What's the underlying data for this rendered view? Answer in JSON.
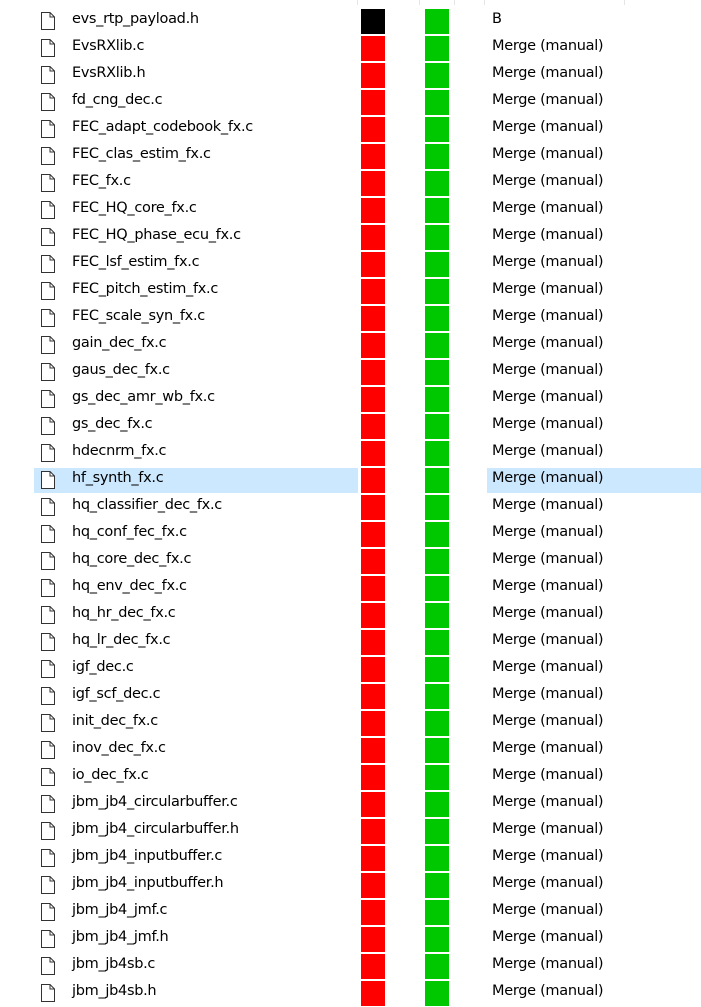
{
  "colors": {
    "red": "#ff0000",
    "green": "#00c800",
    "black": "#000000",
    "selected_row": "#cce8ff"
  },
  "rows": [
    {
      "name": "evs_rtp_payload.h",
      "left_swatch": "black",
      "right_swatch": "green",
      "action": "B",
      "selected": false
    },
    {
      "name": "EvsRXlib.c",
      "left_swatch": "red",
      "right_swatch": "green",
      "action": "Merge (manual)",
      "selected": false
    },
    {
      "name": "EvsRXlib.h",
      "left_swatch": "red",
      "right_swatch": "green",
      "action": "Merge (manual)",
      "selected": false
    },
    {
      "name": "fd_cng_dec.c",
      "left_swatch": "red",
      "right_swatch": "green",
      "action": "Merge (manual)",
      "selected": false
    },
    {
      "name": "FEC_adapt_codebook_fx.c",
      "left_swatch": "red",
      "right_swatch": "green",
      "action": "Merge (manual)",
      "selected": false
    },
    {
      "name": "FEC_clas_estim_fx.c",
      "left_swatch": "red",
      "right_swatch": "green",
      "action": "Merge (manual)",
      "selected": false
    },
    {
      "name": "FEC_fx.c",
      "left_swatch": "red",
      "right_swatch": "green",
      "action": "Merge (manual)",
      "selected": false
    },
    {
      "name": "FEC_HQ_core_fx.c",
      "left_swatch": "red",
      "right_swatch": "green",
      "action": "Merge (manual)",
      "selected": false
    },
    {
      "name": "FEC_HQ_phase_ecu_fx.c",
      "left_swatch": "red",
      "right_swatch": "green",
      "action": "Merge (manual)",
      "selected": false
    },
    {
      "name": "FEC_lsf_estim_fx.c",
      "left_swatch": "red",
      "right_swatch": "green",
      "action": "Merge (manual)",
      "selected": false
    },
    {
      "name": "FEC_pitch_estim_fx.c",
      "left_swatch": "red",
      "right_swatch": "green",
      "action": "Merge (manual)",
      "selected": false
    },
    {
      "name": "FEC_scale_syn_fx.c",
      "left_swatch": "red",
      "right_swatch": "green",
      "action": "Merge (manual)",
      "selected": false
    },
    {
      "name": "gain_dec_fx.c",
      "left_swatch": "red",
      "right_swatch": "green",
      "action": "Merge (manual)",
      "selected": false
    },
    {
      "name": "gaus_dec_fx.c",
      "left_swatch": "red",
      "right_swatch": "green",
      "action": "Merge (manual)",
      "selected": false
    },
    {
      "name": "gs_dec_amr_wb_fx.c",
      "left_swatch": "red",
      "right_swatch": "green",
      "action": "Merge (manual)",
      "selected": false
    },
    {
      "name": "gs_dec_fx.c",
      "left_swatch": "red",
      "right_swatch": "green",
      "action": "Merge (manual)",
      "selected": false
    },
    {
      "name": "hdecnrm_fx.c",
      "left_swatch": "red",
      "right_swatch": "green",
      "action": "Merge (manual)",
      "selected": false
    },
    {
      "name": "hf_synth_fx.c",
      "left_swatch": "red",
      "right_swatch": "green",
      "action": "Merge (manual)",
      "selected": true
    },
    {
      "name": "hq_classifier_dec_fx.c",
      "left_swatch": "red",
      "right_swatch": "green",
      "action": "Merge (manual)",
      "selected": false
    },
    {
      "name": "hq_conf_fec_fx.c",
      "left_swatch": "red",
      "right_swatch": "green",
      "action": "Merge (manual)",
      "selected": false
    },
    {
      "name": "hq_core_dec_fx.c",
      "left_swatch": "red",
      "right_swatch": "green",
      "action": "Merge (manual)",
      "selected": false
    },
    {
      "name": "hq_env_dec_fx.c",
      "left_swatch": "red",
      "right_swatch": "green",
      "action": "Merge (manual)",
      "selected": false
    },
    {
      "name": "hq_hr_dec_fx.c",
      "left_swatch": "red",
      "right_swatch": "green",
      "action": "Merge (manual)",
      "selected": false
    },
    {
      "name": "hq_lr_dec_fx.c",
      "left_swatch": "red",
      "right_swatch": "green",
      "action": "Merge (manual)",
      "selected": false
    },
    {
      "name": "igf_dec.c",
      "left_swatch": "red",
      "right_swatch": "green",
      "action": "Merge (manual)",
      "selected": false
    },
    {
      "name": "igf_scf_dec.c",
      "left_swatch": "red",
      "right_swatch": "green",
      "action": "Merge (manual)",
      "selected": false
    },
    {
      "name": "init_dec_fx.c",
      "left_swatch": "red",
      "right_swatch": "green",
      "action": "Merge (manual)",
      "selected": false
    },
    {
      "name": "inov_dec_fx.c",
      "left_swatch": "red",
      "right_swatch": "green",
      "action": "Merge (manual)",
      "selected": false
    },
    {
      "name": "io_dec_fx.c",
      "left_swatch": "red",
      "right_swatch": "green",
      "action": "Merge (manual)",
      "selected": false
    },
    {
      "name": "jbm_jb4_circularbuffer.c",
      "left_swatch": "red",
      "right_swatch": "green",
      "action": "Merge (manual)",
      "selected": false
    },
    {
      "name": "jbm_jb4_circularbuffer.h",
      "left_swatch": "red",
      "right_swatch": "green",
      "action": "Merge (manual)",
      "selected": false
    },
    {
      "name": "jbm_jb4_inputbuffer.c",
      "left_swatch": "red",
      "right_swatch": "green",
      "action": "Merge (manual)",
      "selected": false
    },
    {
      "name": "jbm_jb4_inputbuffer.h",
      "left_swatch": "red",
      "right_swatch": "green",
      "action": "Merge (manual)",
      "selected": false
    },
    {
      "name": "jbm_jb4_jmf.c",
      "left_swatch": "red",
      "right_swatch": "green",
      "action": "Merge (manual)",
      "selected": false
    },
    {
      "name": "jbm_jb4_jmf.h",
      "left_swatch": "red",
      "right_swatch": "green",
      "action": "Merge (manual)",
      "selected": false
    },
    {
      "name": "jbm_jb4sb.c",
      "left_swatch": "red",
      "right_swatch": "green",
      "action": "Merge (manual)",
      "selected": false
    },
    {
      "name": "jbm_jb4sb.h",
      "left_swatch": "red",
      "right_swatch": "green",
      "action": "Merge (manual)",
      "selected": false
    }
  ]
}
